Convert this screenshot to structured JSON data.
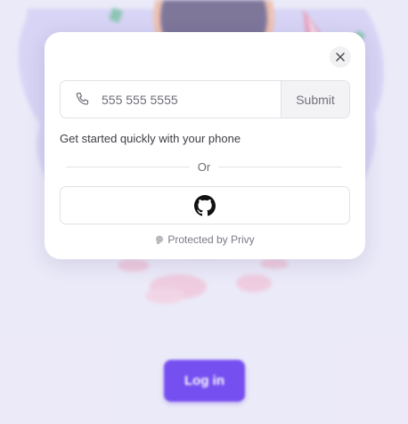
{
  "background": {
    "login_label": "Log in",
    "accent_color": "#6a3ff0"
  },
  "modal": {
    "close_icon": "close-icon",
    "phone": {
      "icon": "phone-icon",
      "placeholder": "555 555 5555",
      "submit_label": "Submit"
    },
    "helper_text": "Get started quickly with your phone",
    "divider_label": "Or",
    "github_icon": "github-icon",
    "footer": {
      "icon": "privy-logo-icon",
      "text": "Protected by Privy"
    }
  }
}
